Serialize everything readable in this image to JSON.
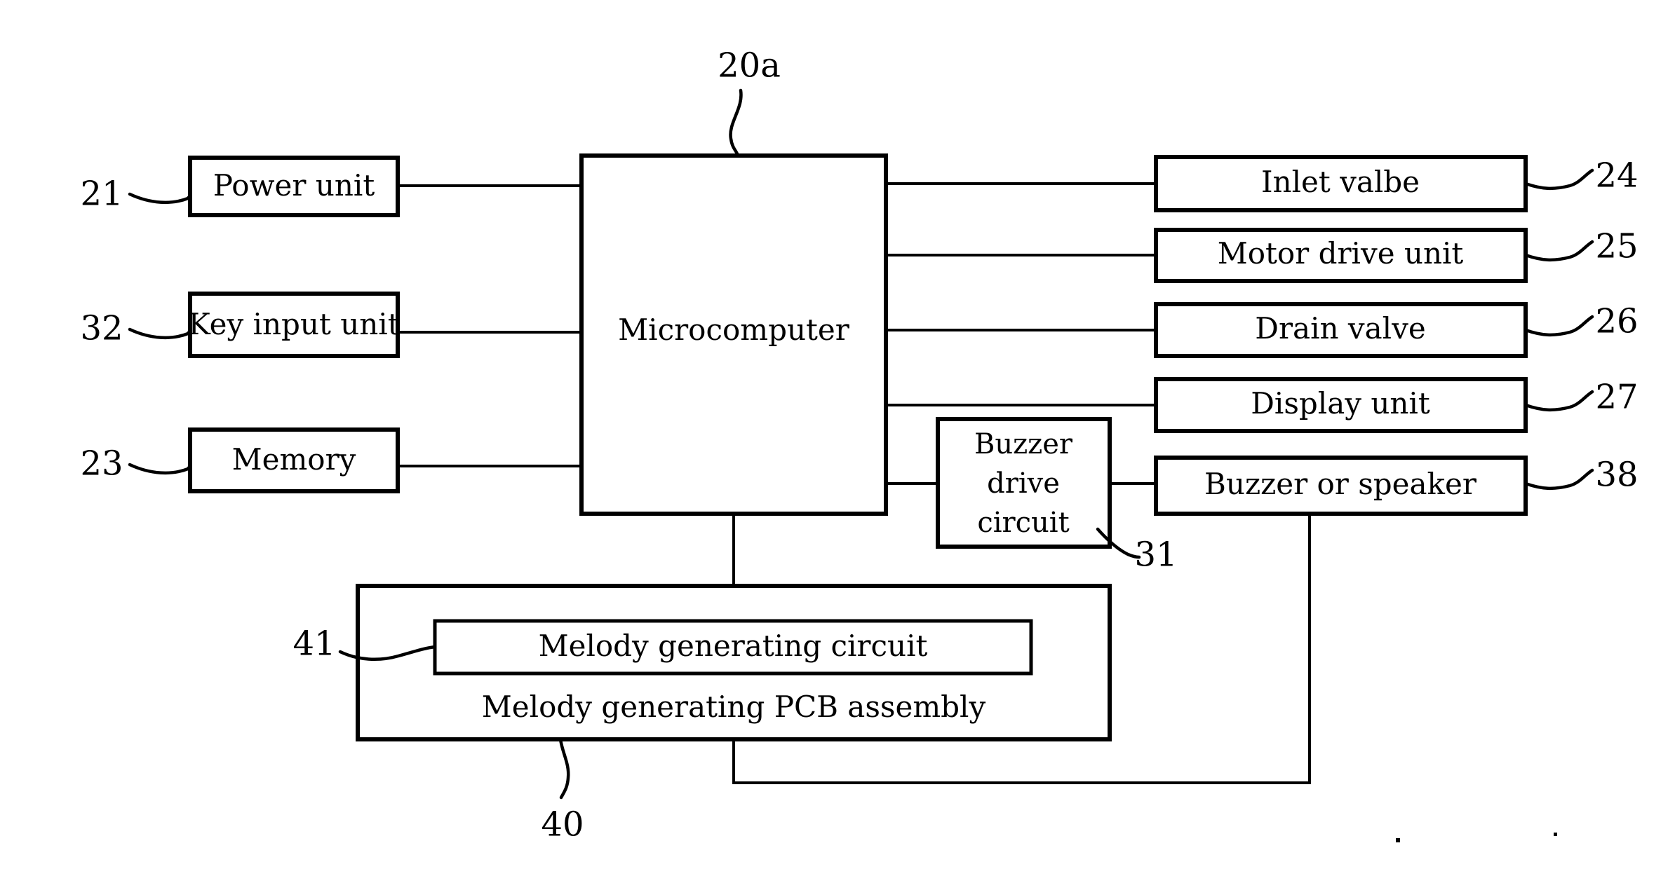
{
  "figure": {
    "type": "patent-block-diagram",
    "description": "Washing machine control block diagram with melody generating PCB assembly",
    "background_color": "#ffffff",
    "line_color": "#000000"
  },
  "blocks": {
    "microcomputer": {
      "label": "Microcomputer",
      "ref": "20a"
    },
    "power_unit": {
      "label": "Power unit",
      "ref": "21"
    },
    "key_input_unit": {
      "label": "Key input unit",
      "ref": "32"
    },
    "memory": {
      "label": "Memory",
      "ref": "23"
    },
    "inlet_valve": {
      "label": "Inlet valbe",
      "ref": "24"
    },
    "motor_drive_unit": {
      "label": "Motor drive unit",
      "ref": "25"
    },
    "drain_valve": {
      "label": "Drain valve",
      "ref": "26"
    },
    "display_unit": {
      "label": "Display unit",
      "ref": "27"
    },
    "buzzer_or_speaker": {
      "label": "Buzzer or speaker",
      "ref": "38"
    },
    "buzzer_drive_circuit": {
      "label_line1": "Buzzer",
      "label_line2": "drive",
      "label_line3": "circuit",
      "ref": "31"
    },
    "melody_generating_circuit": {
      "label": "Melody generating circuit",
      "ref": "41"
    },
    "melody_generating_pcb": {
      "label": "Melody generating PCB assembly",
      "ref": "40"
    }
  },
  "reference_numerals": {
    "left": [
      "21",
      "32",
      "23"
    ],
    "right": [
      "24",
      "25",
      "26",
      "27",
      "38"
    ],
    "top": [
      "20a"
    ],
    "inner": [
      "31",
      "41",
      "40"
    ]
  },
  "connections": [
    {
      "from": "power_unit",
      "to": "microcomputer"
    },
    {
      "from": "key_input_unit",
      "to": "microcomputer"
    },
    {
      "from": "memory",
      "to": "microcomputer"
    },
    {
      "from": "microcomputer",
      "to": "inlet_valve"
    },
    {
      "from": "microcomputer",
      "to": "motor_drive_unit"
    },
    {
      "from": "microcomputer",
      "to": "drain_valve"
    },
    {
      "from": "microcomputer",
      "to": "display_unit"
    },
    {
      "from": "microcomputer",
      "to": "buzzer_drive_circuit"
    },
    {
      "from": "buzzer_drive_circuit",
      "to": "buzzer_or_speaker"
    },
    {
      "from": "microcomputer",
      "to": "melody_generating_pcb"
    },
    {
      "from": "melody_generating_pcb",
      "to": "buzzer_or_speaker"
    }
  ]
}
